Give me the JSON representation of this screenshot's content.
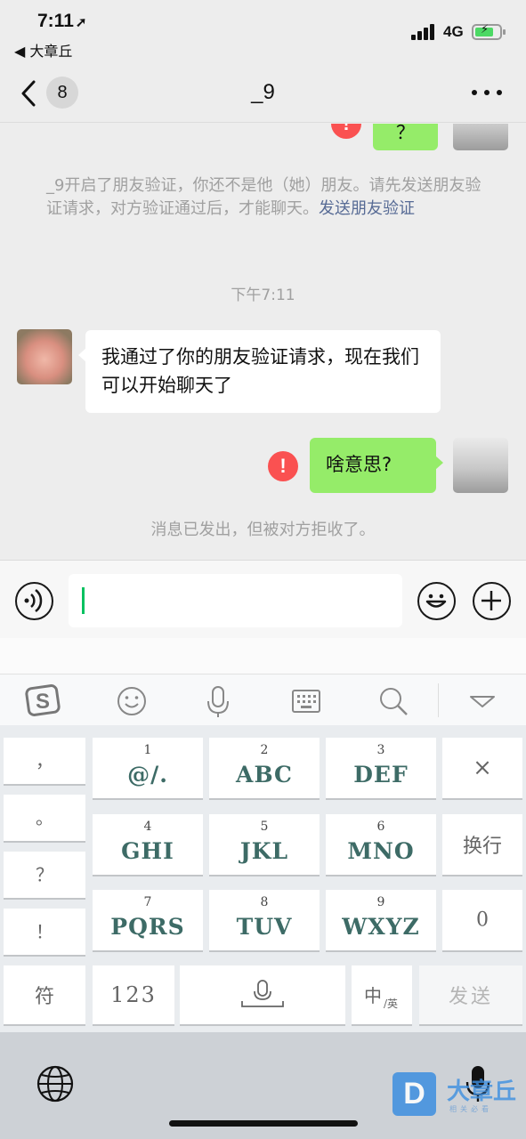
{
  "status_bar": {
    "time": "7:11",
    "location_arrow": "➚",
    "back_app_label": "◀ 大章丘",
    "network": "4G",
    "battery_state": "charging"
  },
  "nav": {
    "unread_count": "8",
    "title": "_9",
    "back_icon": "chevron-left-icon",
    "more_icon": "more-dots-icon"
  },
  "chat": {
    "partial_bubble_text": "？",
    "system_notice": {
      "text": "_9开启了朋友验证，你还不是他（她）朋友。请先发送朋友验证请求，对方验证通过后，才能聊天。",
      "link": "发送朋友验证"
    },
    "timestamp": "下午7:11",
    "incoming_message": "我通过了你的朋友验证请求，现在我们可以开始聊天了",
    "outgoing_message": "啥意思?",
    "error_mark": "!",
    "reject_notice": "消息已发出，但被对方拒收了。"
  },
  "input_bar": {
    "value": "",
    "voice_icon": "voice-icon",
    "emoji_icon": "emoji-icon",
    "plus_icon": "plus-icon"
  },
  "keyboard_toolbar": {
    "icons": [
      "sogou-logo-icon",
      "emoji-face-icon",
      "microphone-icon",
      "keyboard-icon",
      "search-icon",
      "collapse-icon"
    ]
  },
  "keyboard": {
    "punctuation": [
      "，",
      "。",
      "？",
      "！"
    ],
    "keys": [
      {
        "num": "1",
        "letters": "@/."
      },
      {
        "num": "2",
        "letters": "ABC"
      },
      {
        "num": "3",
        "letters": "DEF"
      },
      {
        "num": "4",
        "letters": "GHI"
      },
      {
        "num": "5",
        "letters": "JKL"
      },
      {
        "num": "6",
        "letters": "MNO"
      },
      {
        "num": "7",
        "letters": "PQRS"
      },
      {
        "num": "8",
        "letters": "TUV"
      },
      {
        "num": "9",
        "letters": "WXYZ"
      }
    ],
    "delete": "×",
    "newline": "换行",
    "zero": "0",
    "symbols": "符",
    "numbers": "123",
    "lang_main": "中",
    "lang_sub": "/英",
    "send": "发送"
  },
  "system": {
    "globe_icon": "globe-icon",
    "dictation_icon": "microphone-icon"
  },
  "watermark": {
    "logo_letter": "D",
    "text": "大章丘",
    "sub": "相关必看"
  }
}
